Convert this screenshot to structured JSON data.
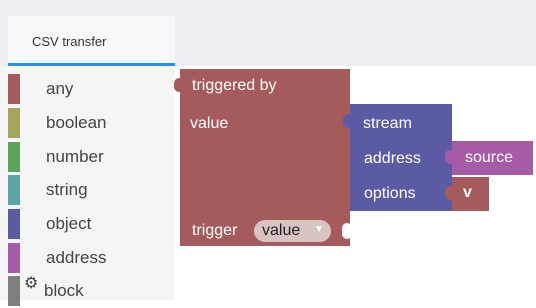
{
  "tab": {
    "label": "CSV transfer"
  },
  "toolbox": {
    "categories": [
      {
        "label": "any",
        "color": "#a55b5b"
      },
      {
        "label": "boolean",
        "color": "#a5a55b"
      },
      {
        "label": "number",
        "color": "#5ba55b"
      },
      {
        "label": "string",
        "color": "#5ba5a5"
      },
      {
        "label": "object",
        "color": "#5b5ba5"
      },
      {
        "label": "address",
        "color": "#a55ba5"
      },
      {
        "label": "block",
        "color": "#7f7f7f",
        "icon": "gear-icon"
      }
    ]
  },
  "blocks": {
    "main": {
      "title": "triggered by",
      "value_label": "value",
      "trigger_label": "trigger",
      "trigger_value": "value",
      "dropdown_arrow": "▼",
      "color": "#a55b5b"
    },
    "stream": {
      "title": "stream",
      "address_label": "address",
      "options_label": "options",
      "color": "#5b5ba5"
    },
    "source": {
      "label": "source",
      "color": "#a55ba5"
    },
    "v": {
      "label": "v",
      "color": "#a55b5b"
    }
  }
}
